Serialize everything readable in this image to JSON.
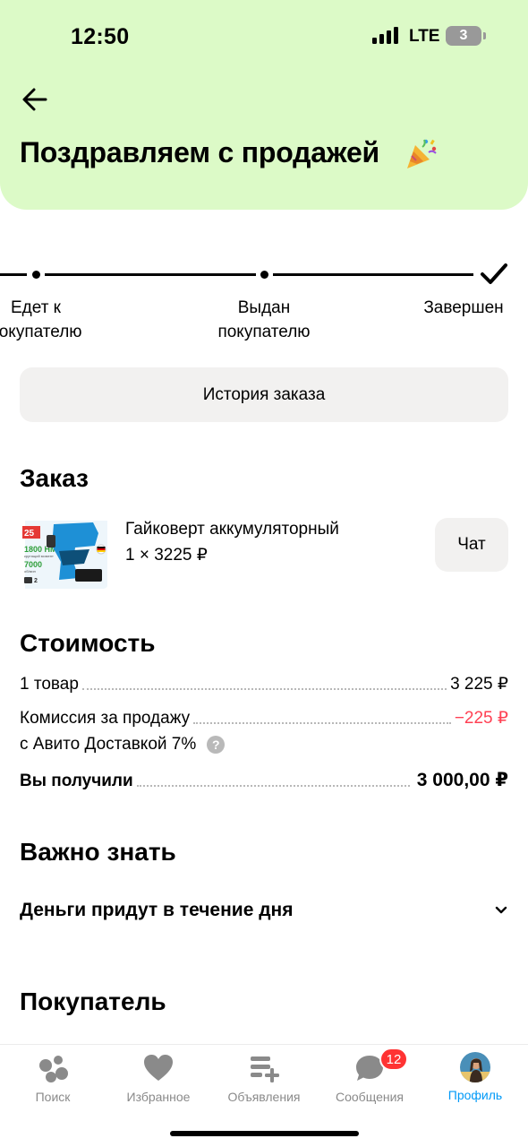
{
  "status_bar": {
    "time": "12:50",
    "network": "LTE",
    "battery": "3"
  },
  "header": {
    "title": "Поздравляем с продажей"
  },
  "progress": {
    "steps": [
      {
        "label": "Едет к\nпокупателю"
      },
      {
        "label": "Выдан\nпокупателю"
      },
      {
        "label": "Завершен"
      }
    ]
  },
  "history_button": "История заказа",
  "order": {
    "heading": "Заказ",
    "product_name": "Гайковерт аккумуляторный",
    "quantity_price": "1 × 3225 ₽",
    "chat_button": "Чат",
    "image_text": {
      "badge": "25",
      "torque": "1800 НМ",
      "torque_sub": "крутящий момент",
      "rpm": "7000",
      "rpm_sub": "об/мин",
      "batteries": "2"
    }
  },
  "cost": {
    "heading": "Стоимость",
    "rows": [
      {
        "label": "1 товар",
        "value": "3 225 ₽"
      },
      {
        "label": "Комиссия за продажу",
        "label2": "с Авито Доставкой 7%",
        "value": "−225 ₽"
      },
      {
        "label": "Вы получили",
        "value": "3 000,00 ₽"
      }
    ],
    "help_icon": "?"
  },
  "important": {
    "heading": "Важно знать",
    "item": "Деньги придут в течение дня"
  },
  "buyer": {
    "heading": "Покупатель"
  },
  "tabbar": {
    "items": [
      {
        "label": "Поиск",
        "icon": "search-icon"
      },
      {
        "label": "Избранное",
        "icon": "heart-icon"
      },
      {
        "label": "Объявления",
        "icon": "listings-icon"
      },
      {
        "label": "Сообщения",
        "icon": "chat-icon",
        "badge": "12"
      },
      {
        "label": "Профиль",
        "icon": "avatar"
      }
    ]
  },
  "colors": {
    "header_bg": "#dcfac7",
    "negative": "#ff4053",
    "active_tab": "#0099f7",
    "badge": "#ff3333"
  }
}
